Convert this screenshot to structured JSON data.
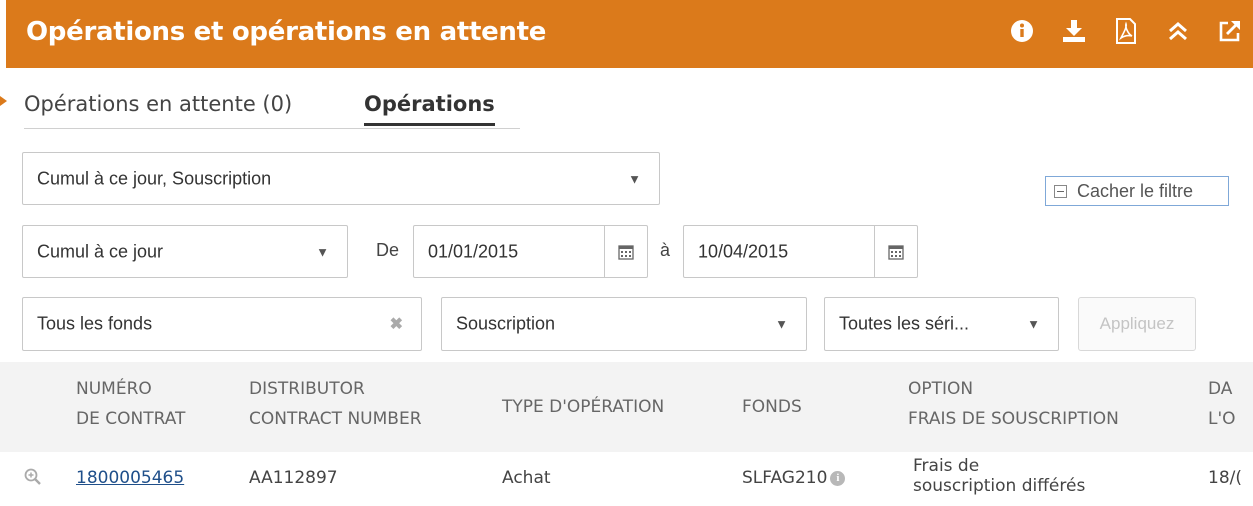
{
  "header": {
    "title": "Opérations et opérations en attente",
    "icons": [
      "info-icon",
      "download-icon",
      "pdf-icon",
      "collapse-icon",
      "external-link-icon"
    ],
    "color": "#db7a1b"
  },
  "tabs": [
    {
      "label": "Opérations en attente (0)",
      "active": false
    },
    {
      "label": "Opérations",
      "active": true
    }
  ],
  "filters": {
    "operation_type_select": "Cumul à ce jour, Souscription",
    "hide_filter_label": "Cacher le filtre",
    "period_select": "Cumul à ce jour",
    "from_label": "De",
    "from_date": "01/01/2015",
    "to_label": "à",
    "to_date": "10/04/2015",
    "funds_input": "Tous les fonds",
    "subscription_select": "Souscription",
    "series_select": "Toutes les séri...",
    "apply_label": "Appliquez"
  },
  "table": {
    "columns": [
      "NUMÉRO\nDE CONTRAT",
      "DISTRIBUTOR\nCONTRACT NUMBER",
      "TYPE D'OPÉRATION",
      "FONDS",
      "OPTION\nFRAIS DE SOUSCRIPTION",
      "DA\nL'O"
    ],
    "rows": [
      {
        "contract_number": "1800005465",
        "distributor_contract": "AA112897",
        "operation_type": "Achat",
        "fund": "SLFAG210",
        "option_line1": "Frais de",
        "option_line2": "souscription différés",
        "date_partial": "18/("
      }
    ]
  }
}
